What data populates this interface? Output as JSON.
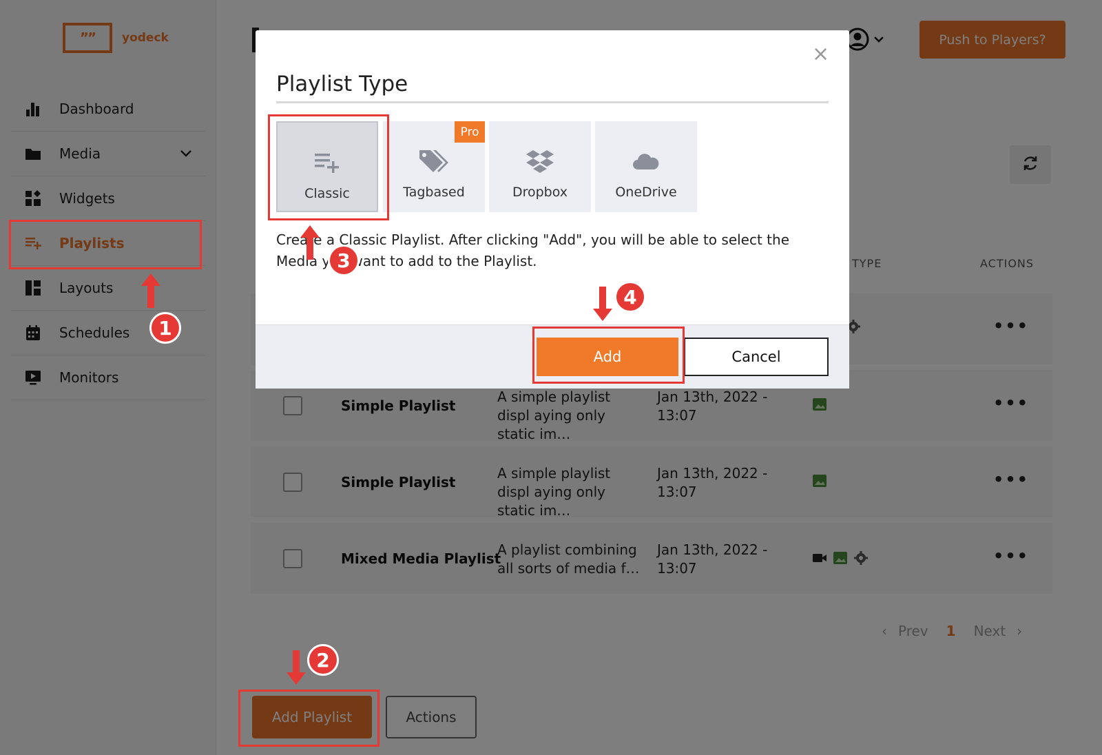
{
  "brand": {
    "logo_mark": "””",
    "name": "yodeck"
  },
  "sidebar": {
    "items": [
      {
        "label": "Dashboard"
      },
      {
        "label": "Media"
      },
      {
        "label": "Widgets"
      },
      {
        "label": "Playlists"
      },
      {
        "label": "Layouts"
      },
      {
        "label": "Schedules"
      },
      {
        "label": "Monitors"
      }
    ]
  },
  "header": {
    "push_label": "Push to Players?"
  },
  "table": {
    "columns": {
      "type": "TYPE",
      "actions": "ACTIONS"
    },
    "rows": [
      {
        "name": "Simple Playlist",
        "desc": "A simple playlist displ aying only static im…",
        "date": "Jan 13th, 2022 - 13:07"
      },
      {
        "name": "Simple Playlist",
        "desc": "A simple playlist displ aying only static im…",
        "date": "Jan 13th, 2022 - 13:07"
      },
      {
        "name": "Mixed Media Playlist",
        "desc": "A playlist combining all sorts of media f…",
        "date": "Jan 13th, 2022 - 13:07"
      }
    ],
    "row_menu": "•••"
  },
  "pager": {
    "prev": "Prev",
    "current": "1",
    "next": "Next"
  },
  "footer": {
    "add_playlist": "Add Playlist",
    "actions": "Actions"
  },
  "modal": {
    "close": "×",
    "title": "Playlist Type",
    "types": [
      {
        "label": "Classic"
      },
      {
        "label": "Tagbased",
        "badge": "Pro"
      },
      {
        "label": "Dropbox"
      },
      {
        "label": "OneDrive"
      }
    ],
    "description": "Create a Classic Playlist. After clicking \"Add\", you will be able to select the Media you want to add to the Playlist.",
    "add": "Add",
    "cancel": "Cancel"
  },
  "annotations": {
    "step1": "1",
    "step2": "2",
    "step3": "3",
    "step4": "4"
  },
  "colors": {
    "accent": "#e8732a",
    "annotation": "#e53935"
  }
}
